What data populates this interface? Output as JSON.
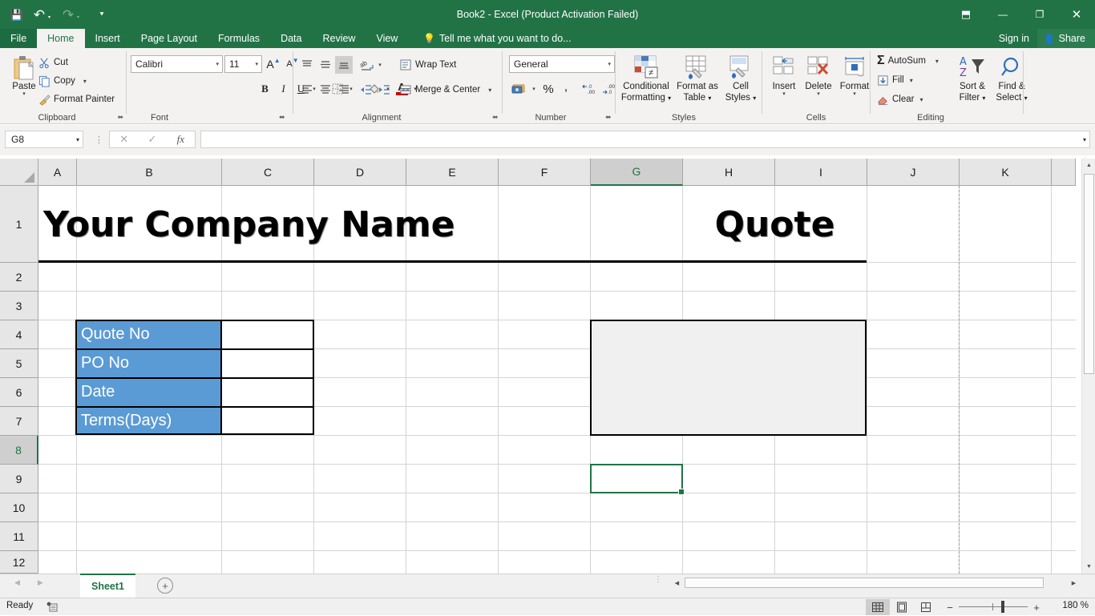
{
  "window": {
    "title": "Book2 - Excel (Product Activation Failed)",
    "quick_access": [
      {
        "name": "save-icon",
        "glyph": "💾"
      },
      {
        "name": "undo-icon",
        "glyph": "↶"
      },
      {
        "name": "redo-icon",
        "glyph": "↷"
      },
      {
        "name": "customize-quick-access-icon",
        "glyph": "⯆"
      }
    ],
    "controls": {
      "ribbon_display_options": "⬒",
      "minimize": "—",
      "restore": "❐",
      "close": "✕"
    }
  },
  "ribbon_tabs": {
    "file": "File",
    "items": [
      "Home",
      "Insert",
      "Page Layout",
      "Formulas",
      "Data",
      "Review",
      "View"
    ],
    "active": "Home",
    "tellme": "Tell me what you want to do...",
    "tellme_icon": "💡",
    "signin": "Sign in",
    "share": "Share",
    "share_icon": "👤",
    "collapse_icon": "⌃"
  },
  "ribbon": {
    "clipboard": {
      "label": "Clipboard",
      "paste": "Paste",
      "cut": "Cut",
      "copy": "Copy",
      "format_painter": "Format Painter",
      "dropdown_caret": "▾",
      "launcher": "⬌"
    },
    "font": {
      "label": "Font",
      "family": "Calibri",
      "size": "11",
      "grow": "A",
      "shrink": "A",
      "bold": "B",
      "italic": "I",
      "underline": "U",
      "borders_icon": "▦",
      "fill_icon": "🖌",
      "color_icon": "A",
      "caret": "▾",
      "launcher": "⬌"
    },
    "alignment": {
      "label": "Alignment",
      "align_top": "≡",
      "align_middle": "≡",
      "align_bottom": "≡",
      "orientation": "⤨",
      "wrap_text": "Wrap Text",
      "align_left": "≡",
      "align_center": "≡",
      "align_right": "≡",
      "decrease_indent": "⇤",
      "increase_indent": "⇥",
      "merge_center": "Merge & Center",
      "caret": "▾",
      "launcher": "⬌"
    },
    "number": {
      "label": "Number",
      "format": "General",
      "accounting": "💵",
      "percent": "%",
      "comma": ",",
      "decrease_decimal": ".00",
      "increase_decimal": ".00",
      "caret": "▾",
      "launcher": "⬌"
    },
    "styles": {
      "label": "Styles",
      "conditional_formatting": "Conditional\nFormatting",
      "conditional_formatting_l1": "Conditional",
      "conditional_formatting_l2": "Formatting",
      "format_as_table_l1": "Format as",
      "format_as_table_l2": "Table",
      "cell_styles_l1": "Cell",
      "cell_styles_l2": "Styles",
      "caret": "▾"
    },
    "cells": {
      "label": "Cells",
      "insert": "Insert",
      "delete": "Delete",
      "format": "Format",
      "caret": "▾"
    },
    "editing": {
      "label": "Editing",
      "autosum": "AutoSum",
      "fill": "Fill",
      "clear": "Clear",
      "sort_filter_l1": "Sort &",
      "sort_filter_l2": "Filter",
      "find_select_l1": "Find &",
      "find_select_l2": "Select",
      "sigma": "Σ",
      "caret": "▾"
    }
  },
  "formula_bar": {
    "name_box": "G8",
    "cancel_icon": "✕",
    "enter_icon": "✓",
    "function_icon": "fx",
    "value": "",
    "caret": "▾",
    "dots": "⋮"
  },
  "grid": {
    "columns": [
      "A",
      "B",
      "C",
      "D",
      "E",
      "F",
      "G",
      "H",
      "I",
      "J",
      "K"
    ],
    "selected_column": "G",
    "rows": [
      "1",
      "2",
      "3",
      "4",
      "5",
      "6",
      "7",
      "8",
      "9",
      "10",
      "11",
      "12"
    ],
    "selected_row": "8",
    "active_cell": "G8",
    "cells": {
      "company_name": "Your Company Name",
      "quote_title": "Quote",
      "quote_no": "Quote No",
      "po_no": "PO No",
      "date": "Date",
      "terms_days": "Terms(Days)"
    },
    "colors": {
      "label_fill": "#5b9bd5",
      "label_text": "#ffffff",
      "grey_box": "#f0f0f0",
      "accent_green": "#217346"
    }
  },
  "sheet_tabs": {
    "prev_icon": "◀",
    "next_icon": "▶",
    "tabs": [
      "Sheet1"
    ],
    "active": "Sheet1",
    "add_sheet": "+"
  },
  "status_bar": {
    "state": "Ready",
    "macro_icon": "▤",
    "views": [
      {
        "name": "normal-view",
        "glyph": "⌸",
        "active": true
      },
      {
        "name": "page-layout-view",
        "glyph": "▤",
        "active": false
      },
      {
        "name": "page-break-preview",
        "glyph": "▥",
        "active": false
      }
    ],
    "zoom_out": "−",
    "zoom_in": "+",
    "zoom_level": "180 %"
  },
  "scrollbars": {
    "up": "▲",
    "down": "▼",
    "left": "◀",
    "right": "▶",
    "split_dots": "⋮"
  }
}
